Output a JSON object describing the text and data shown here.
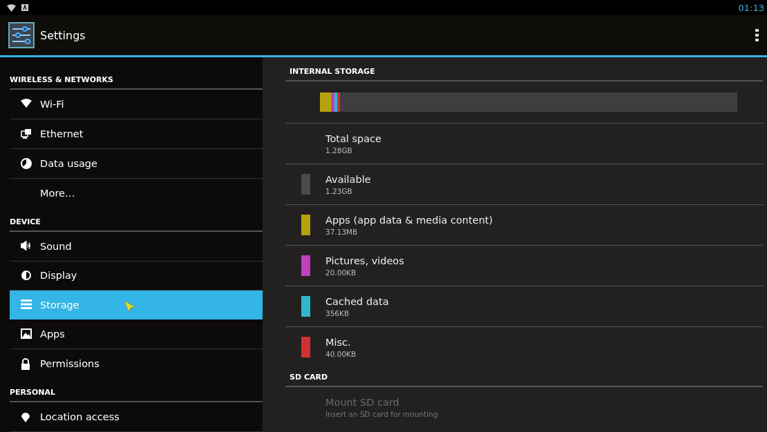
{
  "status_bar": {
    "time": "01:13"
  },
  "action_bar": {
    "title": "Settings"
  },
  "sidebar": [
    {
      "kind": "header",
      "label": "WIRELESS & NETWORKS"
    },
    {
      "kind": "item",
      "label": "Wi-Fi",
      "selected": false
    },
    {
      "kind": "item",
      "label": "Ethernet",
      "selected": false
    },
    {
      "kind": "item",
      "label": "Data usage",
      "selected": false
    },
    {
      "kind": "item",
      "label": "More…",
      "selected": false
    },
    {
      "kind": "header",
      "label": "DEVICE"
    },
    {
      "kind": "item",
      "label": "Sound",
      "selected": false
    },
    {
      "kind": "item",
      "label": "Display",
      "selected": false
    },
    {
      "kind": "item",
      "label": "Storage",
      "selected": true
    },
    {
      "kind": "item",
      "label": "Apps",
      "selected": false
    },
    {
      "kind": "item",
      "label": "Permissions",
      "selected": false
    },
    {
      "kind": "header",
      "label": "PERSONAL"
    },
    {
      "kind": "item",
      "label": "Location access",
      "selected": false
    }
  ],
  "sections": [
    {
      "title": "INTERNAL STORAGE",
      "usage_bar": [
        {
          "color": "#b8a20c",
          "level": 0.027
        },
        {
          "color": "#c040c0",
          "level": 0.008
        },
        {
          "color": "#30b8d0",
          "level": 0.007
        },
        {
          "color": "#d03030",
          "level": 0.006
        }
      ],
      "items": [
        {
          "title": "Total space",
          "summary": "1.28GB",
          "disabled": false
        },
        {
          "title": "Available",
          "summary": "1.23GB",
          "color": "#4a4a4e",
          "disabled": false
        },
        {
          "title": "Apps (app data & media content)",
          "summary": "37.13MB",
          "color": "#b8a20c",
          "disabled": false
        },
        {
          "title": "Pictures, videos",
          "summary": "20.00KB",
          "color": "#c040c0",
          "disabled": false
        },
        {
          "title": "Cached data",
          "summary": "356KB",
          "color": "#30b8d0",
          "disabled": false
        },
        {
          "title": "Misc.",
          "summary": "40.00KB",
          "color": "#d03030",
          "disabled": false
        }
      ]
    },
    {
      "title": "SD CARD",
      "items": [
        {
          "title": "Mount SD card",
          "summary": "Insert an SD card for mounting",
          "disabled": true
        }
      ]
    }
  ]
}
